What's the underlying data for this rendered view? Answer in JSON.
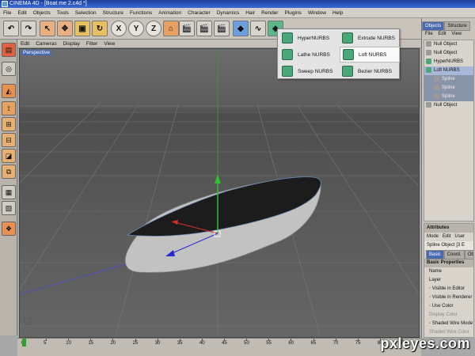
{
  "window": {
    "title": "CINEMA 4D - [Boat me 2.c4d *]"
  },
  "menubar": {
    "items": [
      "File",
      "Edit",
      "Objects",
      "Tools",
      "Selection",
      "Structure",
      "Functions",
      "Animation",
      "Character",
      "Dynamics",
      "Hair",
      "Render",
      "Plugins",
      "Window",
      "Help"
    ]
  },
  "toolbar": {
    "undo_icon": "undo-icon",
    "redo_icon": "redo-icon",
    "axes": [
      "X",
      "Y",
      "Z"
    ]
  },
  "viewport": {
    "menu": [
      "Edit",
      "Cameras",
      "Display",
      "Filter",
      "View"
    ],
    "label": "Perspective"
  },
  "nurbs_menu": {
    "items": [
      "HyperNURBS",
      "Extrude NURBS",
      "Lathe NURBS",
      "Loft NURBS",
      "Sweep NURBS",
      "Bezier NURBS"
    ],
    "selected": "Loft NURBS"
  },
  "objects_panel": {
    "tabs": [
      "Objects",
      "Structure"
    ],
    "menu": [
      "File",
      "Edit",
      "View"
    ],
    "rows": [
      {
        "label": "Null Object",
        "type": "normal"
      },
      {
        "label": "Null Object",
        "type": "normal"
      },
      {
        "label": "HyperNURBS",
        "type": "normal"
      },
      {
        "label": "Loft NURBS",
        "type": "sel"
      },
      {
        "label": "Spline",
        "type": "child"
      },
      {
        "label": "Spline",
        "type": "child"
      },
      {
        "label": "Spline",
        "type": "child"
      },
      {
        "label": "Null Object",
        "type": "normal"
      }
    ]
  },
  "attributes_panel": {
    "title": "Attributes",
    "menu": [
      "Mode",
      "Edit",
      "User"
    ],
    "object": "Spline Object [3 E",
    "tabs": [
      "Basic",
      "Coord.",
      "Object"
    ],
    "section": "Basic Properties",
    "props": [
      {
        "label": "Name",
        "dim": false
      },
      {
        "label": "Layer",
        "dim": false
      },
      {
        "label": "◦ Visible in Editor",
        "dim": false
      },
      {
        "label": "◦ Visible in Renderer",
        "dim": false
      },
      {
        "label": "◦ Use Color",
        "dim": false
      },
      {
        "label": "Display Color",
        "dim": true
      },
      {
        "label": "◦ Shaded Wire Mode",
        "dim": false
      },
      {
        "label": "Shaded Wire Color",
        "dim": true
      }
    ]
  },
  "timeline": {
    "ticks": [
      "0",
      "5",
      "10",
      "15",
      "20",
      "25",
      "30",
      "35",
      "40",
      "45",
      "50",
      "55",
      "60",
      "65",
      "70",
      "75",
      "80",
      "85"
    ]
  },
  "watermark": "pxleyes.com",
  "colors": {
    "accent": "#4a6ab0",
    "nurbs_icon": "#4aa878",
    "boat_top": "#1a1a1a",
    "boat_hull": "#b8b8b8"
  }
}
